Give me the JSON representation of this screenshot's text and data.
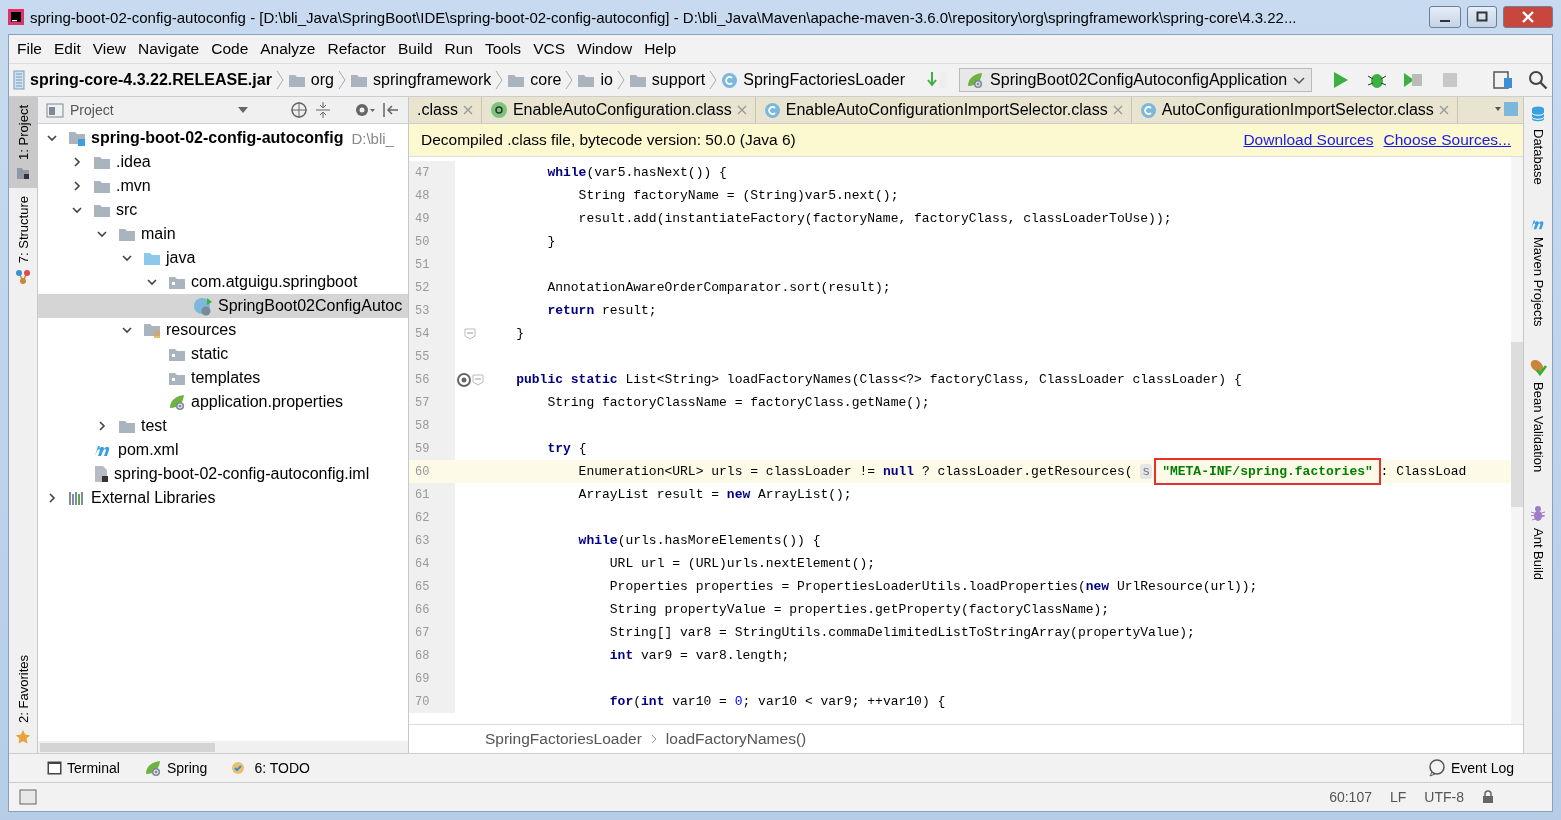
{
  "window": {
    "title": "spring-boot-02-config-autoconfig - [D:\\bli_Java\\SpringBoot\\IDE\\spring-boot-02-config-autoconfig] - D:\\bli_Java\\Maven\\apache-maven-3.6.0\\repository\\org\\springframework\\spring-core\\4.3.22..."
  },
  "menu": [
    "File",
    "Edit",
    "View",
    "Navigate",
    "Code",
    "Analyze",
    "Refactor",
    "Build",
    "Run",
    "Tools",
    "VCS",
    "Window",
    "Help"
  ],
  "navbar": {
    "crumbs": [
      {
        "kind": "jar",
        "label": "spring-core-4.3.22.RELEASE.jar"
      },
      {
        "kind": "folder",
        "label": "org"
      },
      {
        "kind": "folder",
        "label": "springframework"
      },
      {
        "kind": "folder",
        "label": "core"
      },
      {
        "kind": "folder",
        "label": "io"
      },
      {
        "kind": "folder",
        "label": "support"
      },
      {
        "kind": "class",
        "label": "SpringFactoriesLoader"
      }
    ],
    "run_config": "SpringBoot02ConfigAutoconfigApplication"
  },
  "left_stripe": [
    {
      "label": "1: Project",
      "selected": true
    },
    {
      "label": "7: Structure",
      "selected": false
    },
    {
      "label": "2: Favorites",
      "selected": false
    }
  ],
  "project": {
    "title": "Project",
    "tree": [
      {
        "label": "spring-boot-02-config-autoconfig",
        "path": "D:\\bli_",
        "kind": "module",
        "expanded": true,
        "selected": false,
        "children": [
          {
            "label": ".idea",
            "kind": "folder",
            "expanded": false,
            "selected": false
          },
          {
            "label": ".mvn",
            "kind": "folder",
            "expanded": false,
            "selected": false
          },
          {
            "label": "src",
            "kind": "folder",
            "expanded": true,
            "selected": false,
            "children": [
              {
                "label": "main",
                "kind": "folder",
                "expanded": true,
                "selected": false,
                "children": [
                  {
                    "label": "java",
                    "kind": "source",
                    "expanded": true,
                    "selected": false,
                    "children": [
                      {
                        "label": "com.atguigu.springboot",
                        "kind": "package",
                        "expanded": true,
                        "selected": false,
                        "children": [
                          {
                            "label": "SpringBoot02ConfigAutoc",
                            "kind": "spring-class",
                            "selected": true
                          }
                        ]
                      }
                    ]
                  },
                  {
                    "label": "resources",
                    "kind": "resources",
                    "expanded": true,
                    "selected": false,
                    "children": [
                      {
                        "label": "static",
                        "kind": "package",
                        "selected": false
                      },
                      {
                        "label": "templates",
                        "kind": "package",
                        "selected": false
                      },
                      {
                        "label": "application.properties",
                        "kind": "spring-props",
                        "selected": false
                      }
                    ]
                  }
                ]
              },
              {
                "label": "test",
                "kind": "folder",
                "expanded": false,
                "selected": false
              }
            ]
          },
          {
            "label": "pom.xml",
            "kind": "maven",
            "selected": false
          },
          {
            "label": "spring-boot-02-config-autoconfig.iml",
            "kind": "iml",
            "selected": false
          }
        ]
      },
      {
        "label": "External Libraries",
        "kind": "libraries",
        "expanded": false,
        "selected": false
      }
    ]
  },
  "editor": {
    "tabs": [
      {
        "label": ".class",
        "selected": false
      },
      {
        "label": "EnableAutoConfiguration.class",
        "kind": "annotation",
        "selected": false
      },
      {
        "label": "EnableAutoConfigurationImportSelector.class",
        "kind": "class",
        "selected": false
      },
      {
        "label": "AutoConfigurationImportSelector.class",
        "kind": "class",
        "selected": false
      }
    ],
    "notice": {
      "text": "Decompiled .class file, bytecode version: 50.0 (Java 6)",
      "links": [
        "Download Sources",
        "Choose Sources..."
      ]
    },
    "lines": [
      {
        "number": "47",
        "current": false,
        "tokens": [
          {
            "kind": "kw",
            "text": "        while"
          },
          {
            "kind": "plain",
            "text": "(var5.hasNext()) {"
          }
        ]
      },
      {
        "number": "48",
        "current": false,
        "tokens": [
          {
            "kind": "plain",
            "text": "            String factoryName = (String)var5.next();"
          }
        ]
      },
      {
        "number": "49",
        "current": false,
        "tokens": [
          {
            "kind": "plain",
            "text": "            result.add(instantiateFactory(factoryName, factoryClass, classLoaderToUse));"
          }
        ]
      },
      {
        "number": "50",
        "current": false,
        "tokens": [
          {
            "kind": "plain",
            "text": "        }"
          }
        ]
      },
      {
        "number": "51",
        "current": false
      },
      {
        "number": "52",
        "current": false,
        "tokens": [
          {
            "kind": "plain",
            "text": "        AnnotationAwareOrderComparator.sort(result);"
          }
        ]
      },
      {
        "number": "53",
        "current": false,
        "tokens": [
          {
            "kind": "kw",
            "text": "        return"
          },
          {
            "kind": "plain",
            "text": " result;"
          }
        ]
      },
      {
        "number": "54",
        "current": false,
        "tokens": [
          {
            "kind": "plain",
            "text": "    }"
          }
        ]
      },
      {
        "number": "55",
        "current": false
      },
      {
        "number": "56",
        "current": false,
        "tokens": [
          {
            "kind": "kw",
            "text": "    public static"
          },
          {
            "kind": "plain",
            "text": " List<String> loadFactoryNames(Class<?> factoryClass, ClassLoader classLoader) {"
          }
        ]
      },
      {
        "number": "57",
        "current": false,
        "tokens": [
          {
            "kind": "plain",
            "text": "        String factoryClassName = factoryClass.getName();"
          }
        ]
      },
      {
        "number": "58",
        "current": false
      },
      {
        "number": "59",
        "current": false,
        "tokens": [
          {
            "kind": "kw",
            "text": "        try"
          },
          {
            "kind": "plain",
            "text": " {"
          }
        ]
      },
      {
        "number": "60",
        "current": true,
        "tokens": [
          {
            "kind": "plain",
            "text": "            Enumeration<URL> urls = classLoader != "
          },
          {
            "kind": "kw",
            "text": "null"
          },
          {
            "kind": "plain",
            "text": " ? classLoader.getResources( "
          },
          {
            "kind": "hint",
            "text": "s"
          },
          {
            "kind": "str",
            "text": "\"META-INF/spring.factories\"",
            "boxed": true
          },
          {
            "kind": "plain",
            "text": " : ClassLoad"
          }
        ]
      },
      {
        "number": "61",
        "current": false,
        "tokens": [
          {
            "kind": "plain",
            "text": "            ArrayList result = "
          },
          {
            "kind": "kw",
            "text": "new"
          },
          {
            "kind": "plain",
            "text": " ArrayList();"
          }
        ]
      },
      {
        "number": "62",
        "current": false
      },
      {
        "number": "63",
        "current": false,
        "tokens": [
          {
            "kind": "kw",
            "text": "            while"
          },
          {
            "kind": "plain",
            "text": "(urls.hasMoreElements()) {"
          }
        ]
      },
      {
        "number": "64",
        "current": false,
        "tokens": [
          {
            "kind": "plain",
            "text": "                URL url = (URL)urls.nextElement();"
          }
        ]
      },
      {
        "number": "65",
        "current": false,
        "tokens": [
          {
            "kind": "plain",
            "text": "                Properties properties = PropertiesLoaderUtils.loadProperties("
          },
          {
            "kind": "kw",
            "text": "new"
          },
          {
            "kind": "plain",
            "text": " UrlResource(url));"
          }
        ]
      },
      {
        "number": "66",
        "current": false,
        "tokens": [
          {
            "kind": "plain",
            "text": "                String propertyValue = properties.getProperty(factoryClassName);"
          }
        ]
      },
      {
        "number": "67",
        "current": false,
        "tokens": [
          {
            "kind": "plain",
            "text": "                String[] var8 = StringUtils.commaDelimitedListToStringArray(propertyValue);"
          }
        ]
      },
      {
        "number": "68",
        "current": false,
        "tokens": [
          {
            "kind": "kw",
            "text": "                int"
          },
          {
            "kind": "plain",
            "text": " var9 = var8.length;"
          }
        ]
      },
      {
        "number": "69",
        "current": false
      },
      {
        "number": "70",
        "current": false,
        "tokens": [
          {
            "kind": "kw",
            "text": "                for"
          },
          {
            "kind": "plain",
            "text": "("
          },
          {
            "kind": "kw",
            "text": "int"
          },
          {
            "kind": "plain",
            "text": " var10 = "
          },
          {
            "kind": "num",
            "text": "0"
          },
          {
            "kind": "plain",
            "text": "; var10 < var9; ++var10) {"
          }
        ]
      }
    ],
    "breadcrumbs": [
      "SpringFactoriesLoader",
      "loadFactoryNames()"
    ]
  },
  "right_stripe": [
    {
      "kind": "database",
      "label": "Database"
    },
    {
      "kind": "maven",
      "label": "Maven Projects"
    },
    {
      "kind": "bean",
      "label": "Bean Validation"
    },
    {
      "kind": "ant",
      "label": "Ant Build"
    }
  ],
  "tool_bar": [
    {
      "kind": "terminal",
      "label": "Terminal"
    },
    {
      "kind": "spring",
      "label": "Spring"
    },
    {
      "kind": "todo",
      "label": "6: TODO"
    }
  ],
  "event_log": "Event Log",
  "status_bar": {
    "position": "60:107",
    "line_separator": "LF",
    "encoding": "UTF-8"
  }
}
